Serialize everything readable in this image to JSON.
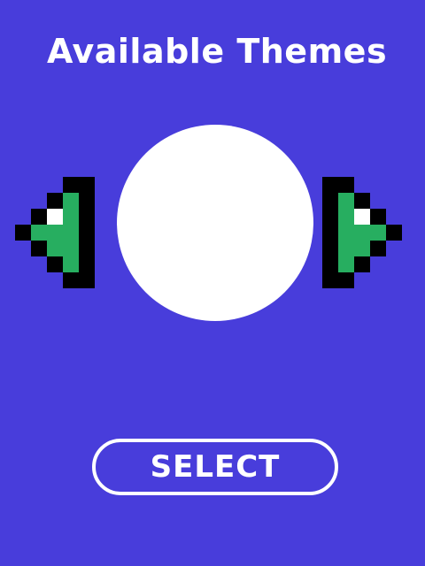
{
  "header": {
    "title": "Available Themes"
  },
  "actions": {
    "select_label": "SELECT"
  },
  "icons": {
    "left": "pixel-arrow-left-icon",
    "right": "pixel-arrow-right-icon"
  },
  "colors": {
    "background": "#483DDB",
    "text": "#FFFFFF",
    "arrow_fill": "#27AE60",
    "arrow_outline": "#000000",
    "arrow_highlight": "#FFFFFF",
    "preview": "#FFFFFF"
  }
}
